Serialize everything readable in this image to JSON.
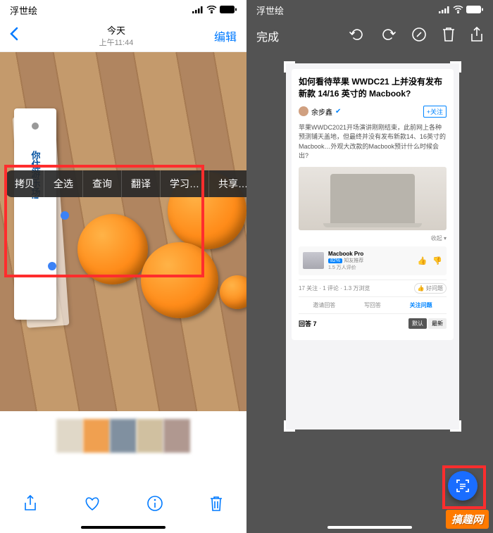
{
  "status": {
    "carrier": "浮世绘",
    "signal_icon": "signal-icon",
    "wifi_icon": "wifi-icon",
    "battery_icon": "battery-icon"
  },
  "left": {
    "header": {
      "day": "今天",
      "time": "上午11:44",
      "edit": "编辑"
    },
    "tag_text": "你住游乐场!",
    "popover": [
      "拷贝",
      "全选",
      "查询",
      "翻译",
      "学习…",
      "共享…"
    ],
    "toolbar": {
      "share": "share-icon",
      "heart": "heart-icon",
      "info": "info-icon",
      "trash": "trash-icon"
    }
  },
  "right": {
    "header": {
      "done": "完成",
      "undo": "undo-icon",
      "redo": "redo-icon",
      "markup": "markup-pen-icon",
      "trash": "trash-icon",
      "share": "share-icon"
    },
    "question": {
      "title": "如何看待苹果 WWDC21 上并没有发布新款 14/16 英寸的 Macbook?",
      "author": "余步鑫",
      "follow": "+关注",
      "body": "苹果WWDC2021开场演讲刚刚结束，此前网上各种预测铺天盖地，但最终并没有发布新款14、16英寸的Macbook…外观大改款的Macbook预计什么时候会出?",
      "collapse": "收起",
      "product": {
        "name": "Macbook Pro",
        "badge_pct": "82%",
        "badge_txt": "知友推荐",
        "rating": "1.5 万人评价"
      },
      "stats": {
        "follow": "17 关注",
        "comment": "1 评论",
        "view": "1.3 万浏览",
        "good_q": "👍 好问题"
      },
      "actions": {
        "invite": "邀请回答",
        "write": "写回答",
        "follow_q": "关注问题"
      },
      "answers": {
        "label": "回答 7",
        "sort_default": "默认",
        "sort_latest": "最新"
      }
    },
    "fab_icon": "fullscreen-icon"
  },
  "watermark": "搞趣网"
}
